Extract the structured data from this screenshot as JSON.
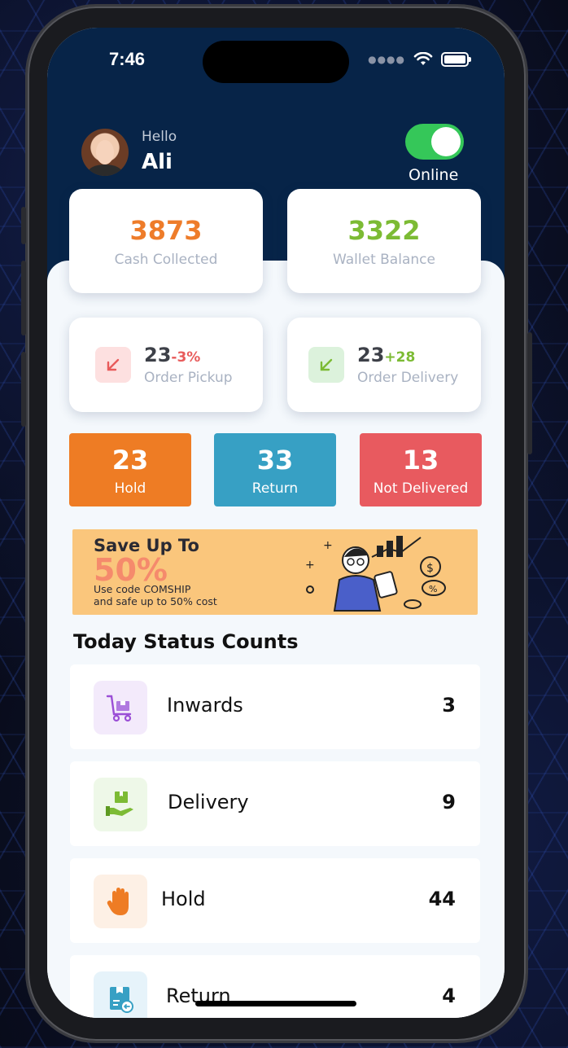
{
  "status_bar": {
    "time": "7:46"
  },
  "header": {
    "greeting": "Hello",
    "user_name": "Ali",
    "online_label": "Online",
    "online_toggle_on": true
  },
  "stats": [
    {
      "value": "3873",
      "label": "Cash Collected",
      "color": "#ee7c2a"
    },
    {
      "value": "3322",
      "label": "Wallet Balance",
      "color": "#7cbb34"
    }
  ],
  "order_cards": [
    {
      "value": "23",
      "delta": "-3%",
      "delta_color": "#e85b5b",
      "label": "Order Pickup",
      "icon": "arrow-down-left-icon",
      "icon_bg": "#fde0e0",
      "icon_color": "#e85b5b"
    },
    {
      "value": "23",
      "delta": "+28",
      "delta_color": "#7cbb34",
      "label": "Order Delivery",
      "icon": "arrow-down-left-icon",
      "icon_bg": "#dcf2dc",
      "icon_color": "#7cbb34"
    }
  ],
  "tiles": [
    {
      "value": "23",
      "label": "Hold",
      "color": "#ee7c24"
    },
    {
      "value": "33",
      "label": "Return",
      "color": "#37a0c4"
    },
    {
      "value": "13",
      "label": "Not Delivered",
      "color": "#e85a5f"
    }
  ],
  "promo": {
    "line1": "Save Up To",
    "line2": "50%",
    "line3": "Use code COMSHIP",
    "line4": "and safe up to 50% cost"
  },
  "section_title": "Today Status Counts",
  "status_counts": [
    {
      "label": "Inwards",
      "count": "3",
      "icon": "cart-icon",
      "icon_bg": "#f3eafb"
    },
    {
      "label": "Delivery",
      "count": "9",
      "icon": "delivery-box-hand-icon",
      "icon_bg": "#eef8e8"
    },
    {
      "label": "Hold",
      "count": "44",
      "icon": "hand-stop-icon",
      "icon_bg": "#fdf0e5"
    },
    {
      "label": "Return",
      "count": "4",
      "icon": "return-box-icon",
      "icon_bg": "#e6f3fa"
    }
  ]
}
